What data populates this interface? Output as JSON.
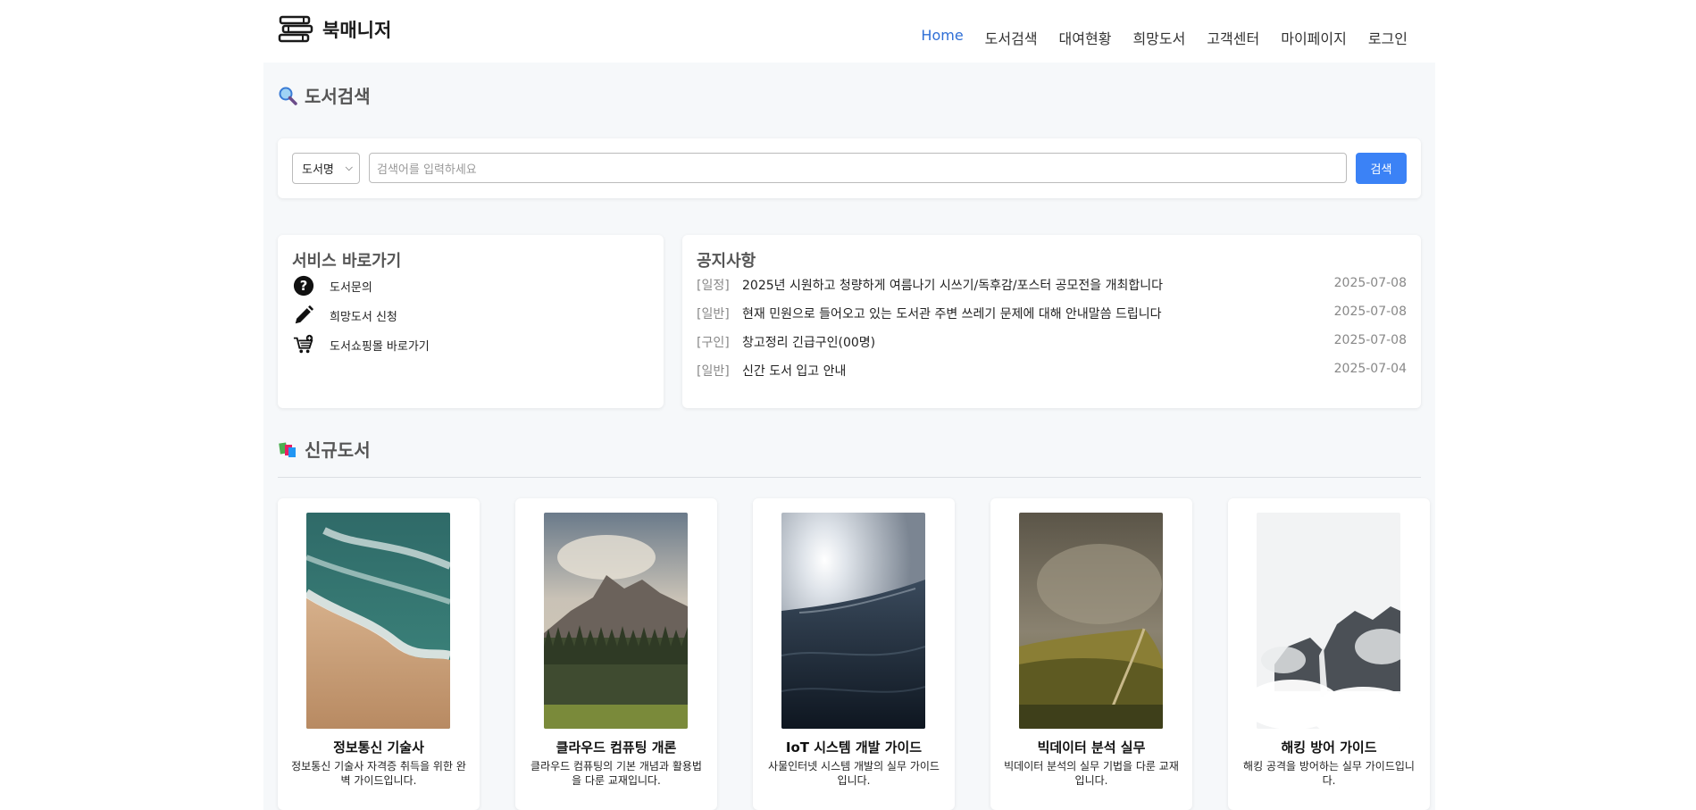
{
  "header": {
    "logo_text": "북매니저",
    "nav": [
      {
        "label": "Home",
        "active": true
      },
      {
        "label": "도서검색"
      },
      {
        "label": "대여현황"
      },
      {
        "label": "희망도서"
      },
      {
        "label": "고객센터"
      },
      {
        "label": "마이페이지"
      },
      {
        "label": "로그인"
      }
    ]
  },
  "search": {
    "title": "도서검색",
    "select_value": "도서명",
    "placeholder": "검색어를 입력하세요",
    "button": "검색"
  },
  "services": {
    "title": "서비스 바로가기",
    "items": [
      {
        "label": "도서문의",
        "icon": "question-icon"
      },
      {
        "label": "희망도서 신청",
        "icon": "pencil-icon"
      },
      {
        "label": "도서쇼핑몰 바로가기",
        "icon": "cart-icon"
      }
    ]
  },
  "notices": {
    "title": "공지사항",
    "items": [
      {
        "tag": "[일정]",
        "text": "2025년 시원하고 청량하게 여름나기 시쓰기/독후감/포스터 공모전을 개최합니다",
        "date": "2025-07-08"
      },
      {
        "tag": "[일반]",
        "text": "현재 민원으로 들어오고 있는 도서관 주변 쓰레기 문제에 대해 안내말씀 드립니다",
        "date": "2025-07-08"
      },
      {
        "tag": "[구인]",
        "text": "창고정리 긴급구인(00명)",
        "date": "2025-07-08"
      },
      {
        "tag": "[일반]",
        "text": "신간 도서 입고 안내",
        "date": "2025-07-04"
      }
    ]
  },
  "new_books": {
    "title": "신규도서",
    "items": [
      {
        "title": "정보통신 기술사",
        "desc": "정보통신 기술사 자격증 취득을 위한 완벽 가이드입니다."
      },
      {
        "title": "클라우드 컴퓨팅 개론",
        "desc": "클라우드 컴퓨팅의 기본 개념과 활용법을 다룬 교재입니다."
      },
      {
        "title": "IoT 시스템 개발 가이드",
        "desc": "사물인터넷 시스템 개발의 실무 가이드입니다."
      },
      {
        "title": "빅데이터 분석 실무",
        "desc": "빅데이터 분석의 실무 기법을 다룬 교재입니다."
      },
      {
        "title": "해킹 방어 가이드",
        "desc": "해킹 공격을 방어하는 실무 가이드입니다."
      }
    ]
  },
  "colors": {
    "accent": "#3b82f6",
    "nav_active": "#2f6fd6",
    "bg": "#f6f8fa"
  }
}
